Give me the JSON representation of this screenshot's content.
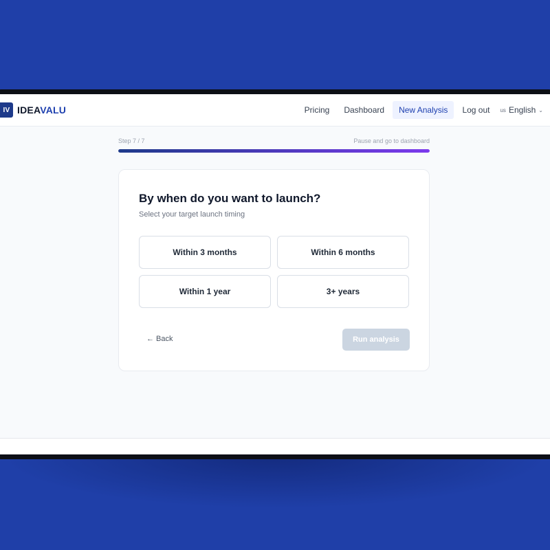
{
  "brand": {
    "badge": "IV",
    "name_part1": "IDEA",
    "name_part2": "VALU"
  },
  "nav": {
    "links": [
      "Pricing",
      "Dashboard",
      "New Analysis",
      "Log out"
    ],
    "active": "New Analysis",
    "language": {
      "code": "us",
      "label": "English",
      "icon": "chevron-down-icon"
    }
  },
  "progress": {
    "step_label": "Step 7 / 7",
    "pause_link": "Pause and go to dashboard",
    "fraction": 1.0
  },
  "question": {
    "title": "By when do you want to launch?",
    "subtitle": "Select your target launch timing",
    "options": [
      "Within 3 months",
      "Within 6 months",
      "Within 1 year",
      "3+ years"
    ]
  },
  "actions": {
    "back": "← Back",
    "run": "Run analysis",
    "run_enabled": false
  },
  "colors": {
    "background": "#1f3fa8",
    "brand": "#1e3a8a",
    "accent_start": "#1e3a8a",
    "accent_end": "#7c3aed",
    "disabled_button": "#cbd5e1"
  }
}
